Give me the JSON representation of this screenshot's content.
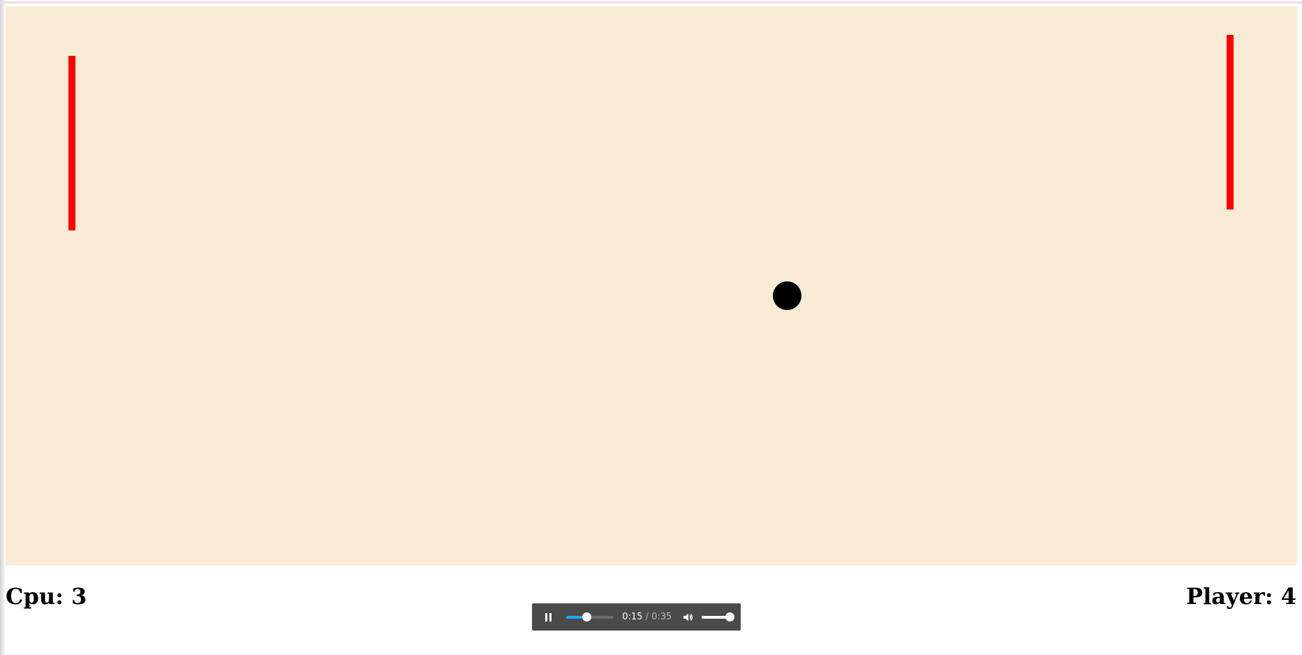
{
  "game": {
    "board_color": "#faebd7",
    "paddle_color": "#ff0000",
    "ball_color": "#000000"
  },
  "scores": {
    "cpu_label": "Cpu: 3",
    "player_label": "Player: 4"
  },
  "audio_player": {
    "state": "playing",
    "pause_icon": "pause-icon",
    "current_time": "0:15",
    "separator": " / ",
    "duration": "0:35",
    "progress": 0.43,
    "volume_icon": "speaker-icon",
    "volume": 1.0,
    "accent_color": "#22a7f0"
  }
}
